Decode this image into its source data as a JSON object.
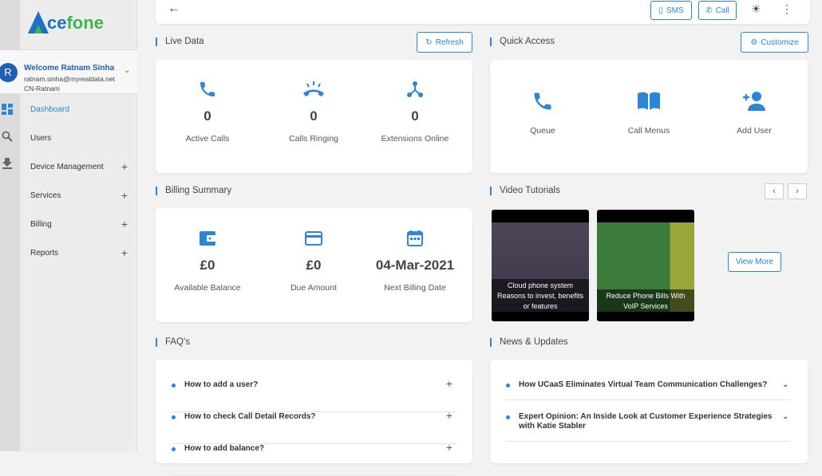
{
  "brand": {
    "logo_text": "Acefone",
    "logo_part1": "ce",
    "logo_part2": "fone"
  },
  "user": {
    "initial": "R",
    "welcome": "Welcome Ratnam Sinha",
    "email": "ratnam.sinha@myrealdata.net",
    "org": "CN-Ratnam"
  },
  "nav": [
    {
      "label": "Dashboard",
      "active": true
    },
    {
      "label": "Users"
    },
    {
      "label": "Device Management",
      "expandable": true
    },
    {
      "label": "Services",
      "expandable": true
    },
    {
      "label": "Billing",
      "expandable": true
    },
    {
      "label": "Reports",
      "expandable": true
    }
  ],
  "topbar": {
    "sms_label": "SMS",
    "call_label": "Call"
  },
  "live_data": {
    "title": "Live Data",
    "refresh_label": "Refresh",
    "stats": [
      {
        "value": "0",
        "label": "Active Calls",
        "icon": "phone-icon"
      },
      {
        "value": "0",
        "label": "Calls Ringing",
        "icon": "phone-ringing-icon"
      },
      {
        "value": "0",
        "label": "Extensions Online",
        "icon": "network-icon"
      }
    ]
  },
  "quick_access": {
    "title": "Quick Access",
    "customize_label": "Customize",
    "items": [
      {
        "label": "Queue",
        "icon": "phone-icon"
      },
      {
        "label": "Call Menus",
        "icon": "book-icon"
      },
      {
        "label": "Add User",
        "icon": "add-user-icon"
      }
    ]
  },
  "billing": {
    "title": "Billing Summary",
    "stats": [
      {
        "value": "£0",
        "label": "Available Balance",
        "icon": "wallet-icon"
      },
      {
        "value": "£0",
        "label": "Due Amount",
        "icon": "credit-card-icon"
      },
      {
        "value": "04-Mar-2021",
        "label": "Next Billing Date",
        "icon": "calendar-icon"
      }
    ]
  },
  "videos": {
    "title": "Video Tutorials",
    "view_more_label": "View More",
    "items": [
      {
        "caption": "Cloud phone system Reasons to invest, benefits or features",
        "overlay": "Cloud phone system - Reasons to invest, benefits or features"
      },
      {
        "caption": "Reduce Phone Bills With VoIP Services",
        "overlay": "Reduce Phone Bills With VoIP Services"
      }
    ]
  },
  "faqs": {
    "title": "FAQ's",
    "items": [
      "How to add a user?",
      "How to check Call Detail Records?",
      "How to add balance?"
    ]
  },
  "news": {
    "title": "News & Updates",
    "items": [
      "How UCaaS Eliminates Virtual Team Communication Challenges?",
      "Expert Opinion: An Inside Look at Customer Experience Strategies with Katie Stabler"
    ]
  },
  "colors": {
    "accent": "#2a86d8",
    "brand_blue": "#1f6fc4",
    "brand_green": "#3fb54a"
  }
}
